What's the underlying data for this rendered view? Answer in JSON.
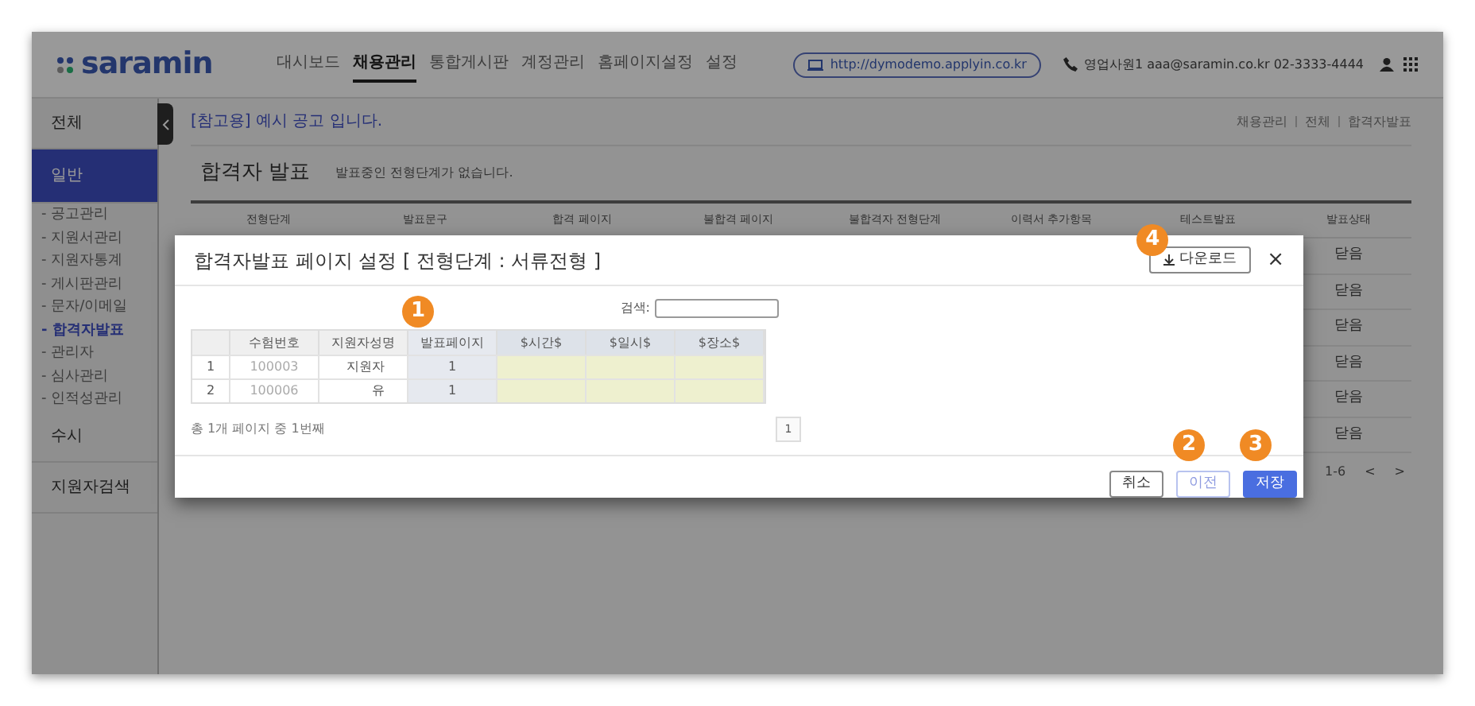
{
  "header": {
    "logo": "saramin",
    "nav": [
      {
        "label": "대시보드",
        "selected": false
      },
      {
        "label": "채용관리",
        "selected": true
      },
      {
        "label": "통합게시판",
        "selected": false
      },
      {
        "label": "계정관리",
        "selected": false
      },
      {
        "label": "홈페이지설정",
        "selected": false
      },
      {
        "label": "설정",
        "selected": false
      }
    ],
    "url": "http://dymodemo.applyin.co.kr",
    "contact": "영업사원1 aaa@saramin.co.kr 02-3333-4444"
  },
  "sidebar": {
    "items": [
      {
        "label": "전체",
        "kind": "section",
        "selected": false
      },
      {
        "label": "일반",
        "kind": "section",
        "selected": true
      },
      {
        "label": "- 공고관리",
        "kind": "sub",
        "selected": false
      },
      {
        "label": "- 지원서관리",
        "kind": "sub",
        "selected": false
      },
      {
        "label": "- 지원자통계",
        "kind": "sub",
        "selected": false
      },
      {
        "label": "- 게시판관리",
        "kind": "sub",
        "selected": false
      },
      {
        "label": "- 문자/이메일",
        "kind": "sub",
        "selected": false
      },
      {
        "label": "- 합격자발표",
        "kind": "sub",
        "selected": true
      },
      {
        "label": "- 관리자",
        "kind": "sub",
        "selected": false
      },
      {
        "label": "- 심사관리",
        "kind": "sub",
        "selected": false
      },
      {
        "label": "- 인적성관리",
        "kind": "sub",
        "selected": false
      },
      {
        "label": "수시",
        "kind": "section",
        "selected": false
      },
      {
        "label": "지원자검색",
        "kind": "section",
        "selected": false
      }
    ]
  },
  "page": {
    "notice": "[참고용] 예시 공고 입니다.",
    "breadcrumb": [
      "채용관리",
      "전체",
      "합격자발표"
    ],
    "heading": "합격자 발표",
    "subtitle": "발표중인 전형단계가 없습니다.",
    "table": {
      "columns": [
        "전형단계",
        "발표문구",
        "합격 페이지",
        "불합격 페이지",
        "불합격자 전형단계",
        "이력서 추가항목",
        "테스트발표",
        "발표상태"
      ],
      "status_cells": [
        "닫음",
        "닫음",
        "닫음",
        "닫음",
        "닫음",
        "닫음"
      ]
    },
    "pagination": {
      "range": "1-6",
      "prev": "<",
      "next": ">"
    }
  },
  "modal": {
    "title": "합격자발표 페이지 설정 [ 전형단계 : 서류전형 ]",
    "download_button": {
      "label": "다운로드",
      "badge": "4"
    },
    "close": "×",
    "search_label": "검색:",
    "table": {
      "columns": [
        {
          "kind": "plain"
        },
        {
          "label": "수험번호",
          "kind": "plain"
        },
        {
          "label": "지원자성명",
          "kind": "plain"
        },
        {
          "label": "발표페이지",
          "kind": "highlight",
          "badge": "1"
        },
        {
          "label": "$시간$",
          "kind": "input"
        },
        {
          "label": "$일시$",
          "kind": "input"
        },
        {
          "label": "$장소$",
          "kind": "input"
        }
      ],
      "rows": [
        [
          "1",
          "100003",
          "지원자",
          "1",
          "",
          "",
          ""
        ],
        [
          "2",
          "100006",
          "유",
          "1",
          "",
          "",
          ""
        ]
      ]
    },
    "info": "총 1개 페이지 중 1번째",
    "page": "1",
    "buttons": [
      {
        "label": "취소",
        "kind": "default"
      },
      {
        "label": "이전",
        "kind": "outline",
        "badge": "2"
      },
      {
        "label": "저장",
        "kind": "primary",
        "badge": "3"
      }
    ]
  }
}
